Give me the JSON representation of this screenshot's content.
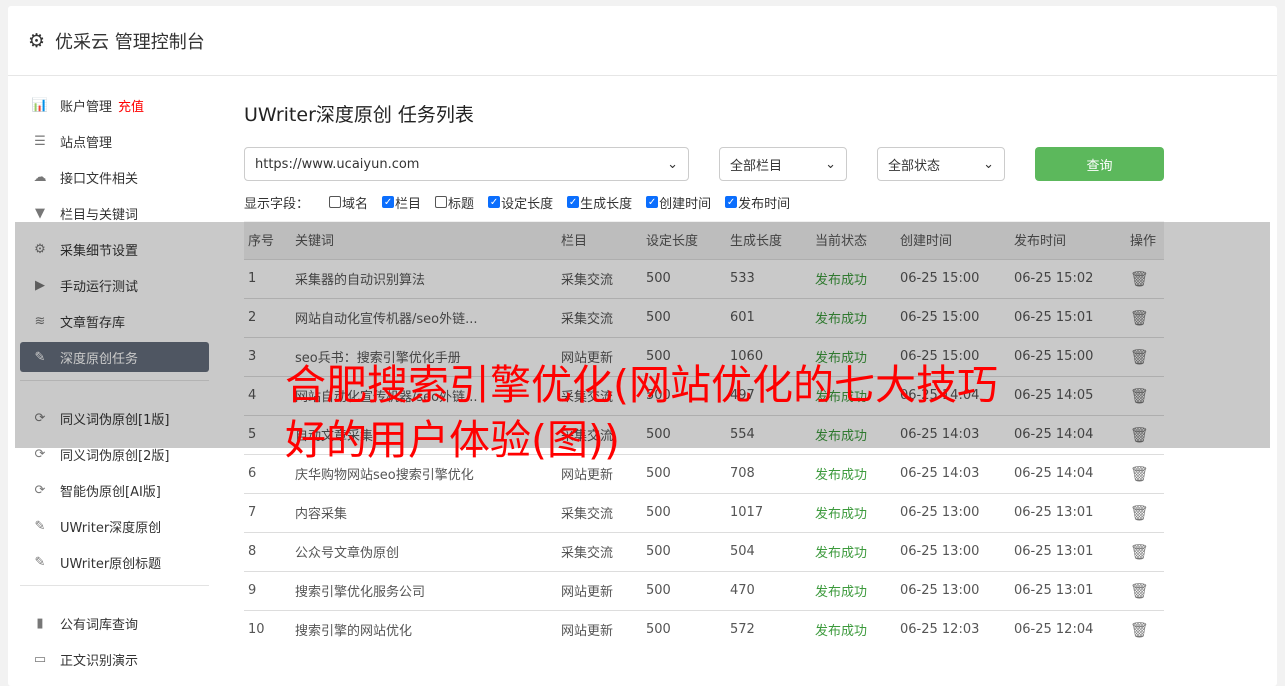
{
  "header": {
    "title": "优采云 管理控制台",
    "icon": "gear-icon"
  },
  "sidebar": {
    "items": [
      {
        "label": "账户管理",
        "extra": "充值",
        "icon": "bar-chart-icon"
      },
      {
        "label": "站点管理",
        "icon": "server-icon"
      },
      {
        "label": "接口文件相关",
        "icon": "cloud-upload-icon"
      },
      {
        "label": "栏目与关键词",
        "icon": "filter-icon"
      },
      {
        "label": "采集细节设置",
        "icon": "gears-icon"
      },
      {
        "label": "手动运行测试",
        "icon": "play-icon"
      },
      {
        "label": "文章暂存库",
        "icon": "database-icon"
      },
      {
        "label": "深度原创任务",
        "icon": "edit-icon"
      },
      {
        "label": "同义词伪原创[1版]",
        "icon": "refresh-icon"
      },
      {
        "label": "同义词伪原创[2版]",
        "icon": "refresh-icon"
      },
      {
        "label": "智能伪原创[AI版]",
        "icon": "refresh-icon"
      },
      {
        "label": "UWriter深度原创",
        "icon": "edit-icon"
      },
      {
        "label": "UWriter原创标题",
        "icon": "edit-icon"
      },
      {
        "label": "公有词库查询",
        "icon": "book-icon"
      },
      {
        "label": "正文识别演示",
        "icon": "monitor-icon"
      }
    ]
  },
  "main": {
    "title": "UWriter深度原创 任务列表",
    "site_select": "https://www.ucaiyun.com",
    "column_select": "全部栏目",
    "status_select": "全部状态",
    "query_button": "查询",
    "fields_label": "显示字段：",
    "fields": [
      {
        "label": "域名",
        "checked": false
      },
      {
        "label": "栏目",
        "checked": true
      },
      {
        "label": "标题",
        "checked": false
      },
      {
        "label": "设定长度",
        "checked": true
      },
      {
        "label": "生成长度",
        "checked": true
      },
      {
        "label": "创建时间",
        "checked": true
      },
      {
        "label": "发布时间",
        "checked": true
      }
    ],
    "columns": [
      "序号",
      "关键词",
      "栏目",
      "设定长度",
      "生成长度",
      "当前状态",
      "创建时间",
      "发布时间",
      "操作"
    ],
    "rows": [
      [
        "1",
        "采集器的自动识别算法",
        "采集交流",
        "500",
        "533",
        "发布成功",
        "06-25 15:00",
        "06-25 15:02"
      ],
      [
        "2",
        "网站自动化宣传机器/seo外链...",
        "采集交流",
        "500",
        "601",
        "发布成功",
        "06-25 15:00",
        "06-25 15:01"
      ],
      [
        "3",
        "seo兵书：搜索引擎优化手册",
        "网站更新",
        "500",
        "1060",
        "发布成功",
        "06-25 15:00",
        "06-25 15:00"
      ],
      [
        "4",
        "网站自动化宣传机器/seo外链...",
        "采集交流",
        "500",
        "497",
        "发布成功",
        "06-25 14:04",
        "06-25 14:05"
      ],
      [
        "5",
        "自动文章采集",
        "采集交流",
        "500",
        "554",
        "发布成功",
        "06-25 14:03",
        "06-25 14:04"
      ],
      [
        "6",
        "庆华购物网站seo搜索引擎优化",
        "网站更新",
        "500",
        "708",
        "发布成功",
        "06-25 14:03",
        "06-25 14:04"
      ],
      [
        "7",
        "内容采集",
        "采集交流",
        "500",
        "1017",
        "发布成功",
        "06-25 13:00",
        "06-25 13:01"
      ],
      [
        "8",
        "公众号文章伪原创",
        "采集交流",
        "500",
        "504",
        "发布成功",
        "06-25 13:00",
        "06-25 13:01"
      ],
      [
        "9",
        "搜索引擎优化服务公司",
        "网站更新",
        "500",
        "470",
        "发布成功",
        "06-25 13:00",
        "06-25 13:01"
      ],
      [
        "10",
        "搜索引擎的网站优化",
        "网站更新",
        "500",
        "572",
        "发布成功",
        "06-25 12:03",
        "06-25 12:04"
      ]
    ]
  },
  "overlay_headline": "合肥搜索引擎优化(网站优化的七大技巧好的用户体验(图))",
  "colors": {
    "accent": "#5cb85c",
    "active": "#656e7d",
    "success": "#3c9a3c",
    "headline": "#ff0000"
  }
}
